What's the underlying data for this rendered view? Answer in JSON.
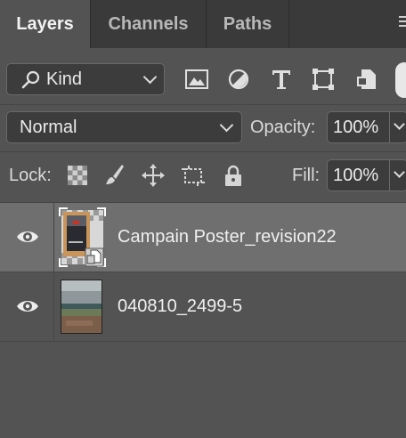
{
  "tabs": [
    {
      "label": "Layers",
      "active": true
    },
    {
      "label": "Channels",
      "active": false
    },
    {
      "label": "Paths",
      "active": false
    }
  ],
  "filter": {
    "kind_label": "Kind",
    "icons": [
      "image-filter-icon",
      "adjustment-filter-icon",
      "type-filter-icon",
      "shape-filter-icon",
      "smart-object-filter-icon"
    ]
  },
  "blend": {
    "mode": "Normal",
    "opacity_label": "Opacity:",
    "opacity_value": "100%"
  },
  "lock": {
    "label": "Lock:",
    "icons": [
      "lock-transparent-pixels-icon",
      "lock-image-pixels-icon",
      "lock-position-icon",
      "lock-artboard-icon",
      "lock-all-icon"
    ],
    "fill_label": "Fill:",
    "fill_value": "100%"
  },
  "layers": [
    {
      "name": "Campain Poster_revision22",
      "visible": true,
      "selected": true,
      "smart_object": true
    },
    {
      "name": "040810_2499-5",
      "visible": true,
      "selected": false,
      "smart_object": false
    }
  ],
  "colors": {
    "panel": "#535353",
    "tabbar": "#3a3a3a",
    "selected_layer": "#6f6f6f"
  }
}
